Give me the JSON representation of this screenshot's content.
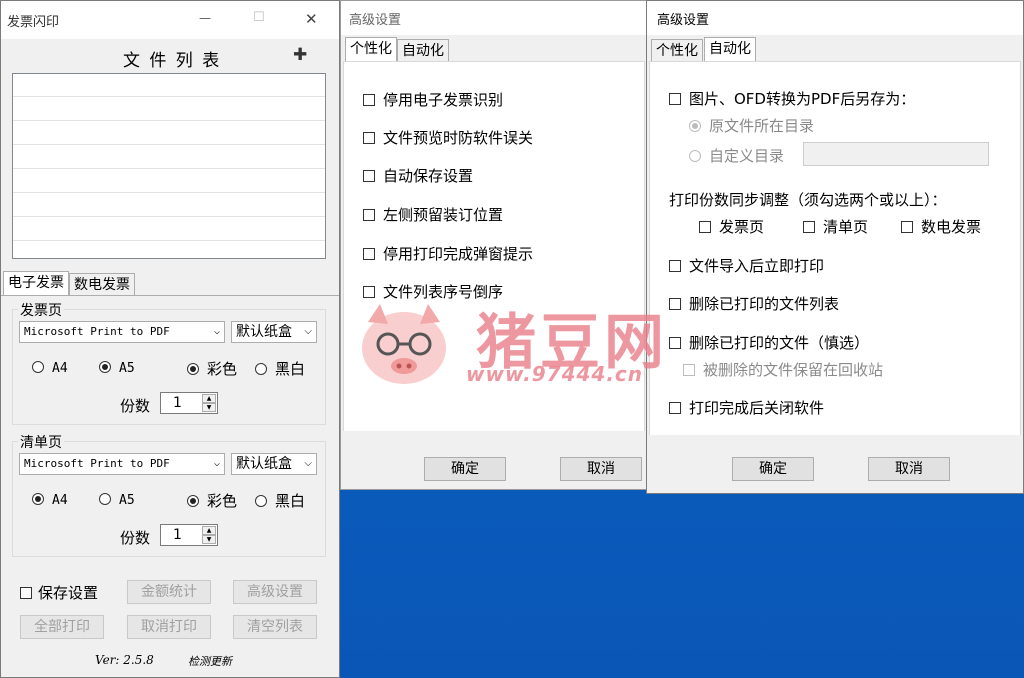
{
  "main_window": {
    "title": "发票闪印",
    "controls": {
      "minimize": "—",
      "maximize": "☐",
      "close": "✕"
    },
    "file_list_title": "文 件 列 表",
    "add_icon": "✚",
    "tabs": [
      "电子发票",
      "数电发票"
    ],
    "invoice_group": {
      "title": "发票页",
      "printer": "Microsoft Print to PDF",
      "tray": "默认纸盒",
      "size_a4": "A4",
      "size_a5": "A5",
      "color": "彩色",
      "bw": "黑白",
      "copies_label": "份数",
      "copies": "1"
    },
    "list_group": {
      "title": "清单页",
      "printer": "Microsoft Print to PDF",
      "tray": "默认纸盒",
      "size_a4": "A4",
      "size_a5": "A5",
      "color": "彩色",
      "bw": "黑白",
      "copies_label": "份数",
      "copies": "1"
    },
    "save_settings": "保存设置",
    "amount_stats": "金额统计",
    "advanced_settings": "高级设置",
    "print_all": "全部打印",
    "cancel_print": "取消打印",
    "clear_list": "清空列表",
    "version": "Ver: 2.5.8",
    "check_update": "检测更新"
  },
  "dialog1": {
    "title": "高级设置",
    "tabs": [
      "个性化",
      "自动化"
    ],
    "options": [
      "停用电子发票识别",
      "文件预览时防软件误关",
      "自动保存设置",
      "左侧预留装订位置",
      "停用打印完成弹窗提示",
      "文件列表序号倒序"
    ],
    "ok": "确定",
    "cancel": "取消"
  },
  "dialog2": {
    "title": "高级设置",
    "tabs": [
      "个性化",
      "自动化"
    ],
    "convert_option": "图片、OFD转换为PDF后另存为：",
    "radio_original": "原文件所在目录",
    "radio_custom": "自定义目录",
    "sync_label": "打印份数同步调整（须勾选两个或以上）：",
    "sync_invoice": "发票页",
    "sync_list": "清单页",
    "sync_digital": "数电发票",
    "print_after_import": "文件导入后立即打印",
    "delete_printed_list": "删除已打印的文件列表",
    "delete_printed_files": "删除已打印的文件（慎选）",
    "keep_in_recycle": "被删除的文件保留在回收站",
    "close_after_print": "打印完成后关闭软件",
    "ok": "确定",
    "cancel": "取消"
  },
  "watermark": {
    "brand": "猪豆网",
    "url": "www.97444.cn"
  }
}
